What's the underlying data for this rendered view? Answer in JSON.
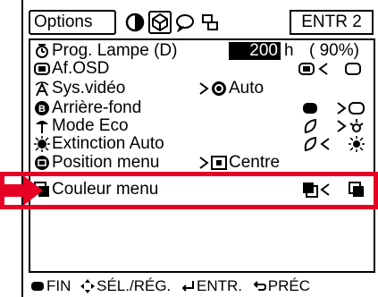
{
  "header": {
    "tab_options": "Options",
    "tab_icons": [
      "picture-tab-icon",
      "options-tab-icon",
      "language-tab-icon",
      "status-tab-icon"
    ],
    "input_label": "ENTR 2"
  },
  "menu": {
    "items": [
      {
        "label": "Prog. Lampe (D)",
        "icon": "lamp-timer-icon",
        "value": "200",
        "unit": "h",
        "percent": "( 90%)"
      },
      {
        "label": "Af.OSD",
        "icon": "osd-icon"
      },
      {
        "label": "Sys.vidéo",
        "icon": "video-system-icon",
        "value": "Auto"
      },
      {
        "label": "Arrière-fond",
        "icon": "background-icon"
      },
      {
        "label": "Mode Eco",
        "icon": "eco-mode-icon"
      },
      {
        "label": "Extinction Auto",
        "icon": "auto-power-off-icon"
      },
      {
        "label": "Position menu",
        "icon": "menu-position-icon",
        "value": "Centre"
      },
      {
        "label": "Couleur menu",
        "icon": "menu-color-icon"
      }
    ]
  },
  "footer": {
    "end": "FIN",
    "select": "SÉL./RÉG.",
    "enter": "ENTR.",
    "back": "PRÉC"
  },
  "colors": {
    "highlight": "#e60023",
    "text": "#000000",
    "background": "#ffffff"
  }
}
